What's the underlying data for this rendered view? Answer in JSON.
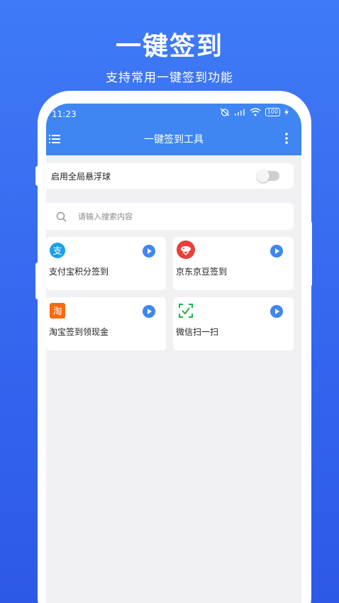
{
  "hero": {
    "title": "一键签到",
    "subtitle": "支持常用一键签到功能"
  },
  "status_bar": {
    "time": "11:23",
    "battery": "100"
  },
  "toolbar": {
    "title": "一键签到工具",
    "menu_icon": "menu-icon",
    "more_icon": "more-vertical-icon"
  },
  "float_ball": {
    "label": "启用全局悬浮球",
    "enabled": false
  },
  "search": {
    "placeholder": "请输入搜索内容"
  },
  "tools": [
    {
      "label": "支付宝积分签到",
      "icon": "alipay-icon",
      "color": "#1AA0E8"
    },
    {
      "label": "京东京豆签到",
      "icon": "jd-icon",
      "color": "#E8403A"
    },
    {
      "label": "淘宝签到领现金",
      "icon": "taobao-icon",
      "color": "#F96A0E"
    },
    {
      "label": "微信扫一扫",
      "icon": "wechat-scan-icon",
      "color": "#1DB64A"
    }
  ],
  "colors": {
    "background": "#3566EE",
    "appbar": "#3F86F2",
    "play": "#3F86F2"
  }
}
